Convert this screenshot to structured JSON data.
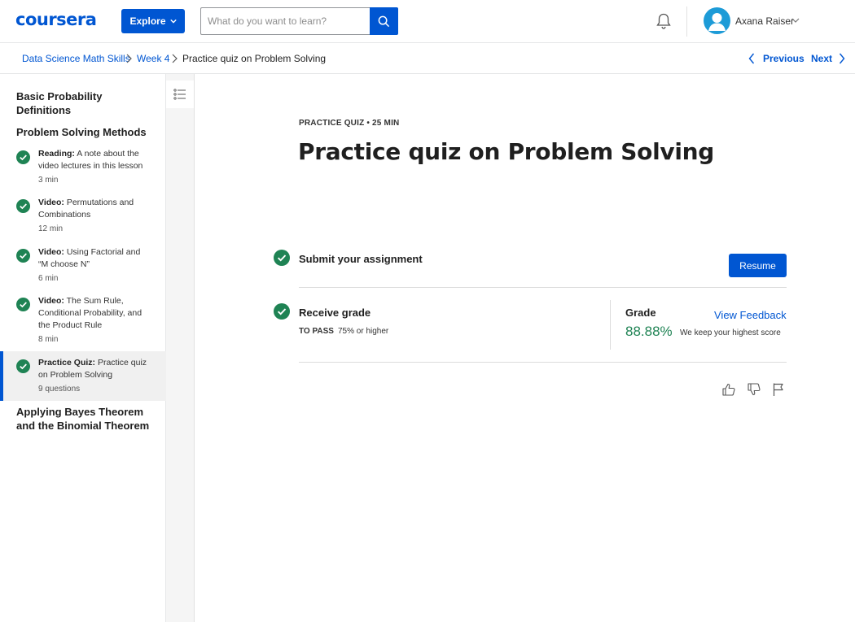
{
  "header": {
    "logo": "coursera",
    "explore_label": "Explore",
    "search_placeholder": "What do you want to learn?",
    "user_name": "Axana Raiser"
  },
  "breadcrumb": {
    "items": [
      "Data Science Math Skills",
      "Week 4",
      "Practice quiz on Problem Solving"
    ],
    "previous_label": "Previous",
    "next_label": "Next"
  },
  "sidebar": {
    "modules": [
      {
        "title": "Basic Probability Definitions"
      },
      {
        "title": "Problem Solving Methods"
      },
      {
        "title": "Applying Bayes Theorem and the Binomial Theorem"
      }
    ],
    "items": [
      {
        "type": "Reading:",
        "name": "A note about the video lectures in this lesson",
        "duration": "3 min",
        "completed": true,
        "active": false
      },
      {
        "type": "Video:",
        "name": "Permutations and Combinations",
        "duration": "12 min",
        "completed": true,
        "active": false
      },
      {
        "type": "Video:",
        "name": "Using Factorial and “M choose N”",
        "duration": "6 min",
        "completed": true,
        "active": false
      },
      {
        "type": "Video:",
        "name": "The Sum Rule, Conditional Probability, and the Product Rule",
        "duration": "8 min",
        "completed": true,
        "active": false
      },
      {
        "type": "Practice Quiz:",
        "name": "Practice quiz on Problem Solving",
        "duration": "9 questions",
        "completed": true,
        "active": true
      }
    ]
  },
  "main": {
    "eyebrow": "PRACTICE QUIZ • 25 MIN",
    "title": "Practice quiz on Problem Solving",
    "submit_title": "Submit your assignment",
    "resume_label": "Resume",
    "receive_title": "Receive grade",
    "to_pass_label": "TO PASS",
    "to_pass_value": "75% or higher",
    "grade_label": "Grade",
    "view_feedback_label": "View Feedback",
    "grade_value": "88.88%",
    "grade_note": "We keep your highest score"
  },
  "colors": {
    "brand_blue": "#0056d2",
    "success_green": "#1f8354",
    "avatar_blue": "#1d9bd7"
  },
  "icons": [
    "search-icon",
    "bell-icon",
    "avatar-icon",
    "chevron-down-icon",
    "chevron-right-icon",
    "chevron-left-icon",
    "checkmark-circle-icon",
    "list-icon",
    "thumbs-up-icon",
    "thumbs-down-icon",
    "flag-icon"
  ]
}
